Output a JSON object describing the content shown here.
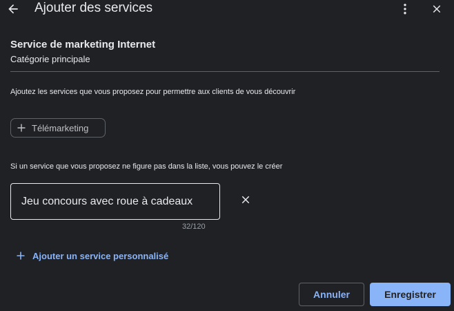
{
  "header": {
    "title": "Ajouter des services",
    "back_icon": "arrow-back-icon",
    "more_icon": "more-vert-icon",
    "close_icon": "close-icon"
  },
  "category": {
    "name": "Service de marketing Internet",
    "type": "Catégorie principale"
  },
  "suggested": {
    "hint": "Ajoutez les services que vous proposez pour permettre aux clients de vous découvrir",
    "chips": [
      {
        "label": "Télémarketing",
        "icon": "plus-icon"
      }
    ]
  },
  "custom": {
    "hint": "Si un service que vous proposez ne figure pas dans la liste, vous pouvez le créer",
    "input_value": "Jeu concours avec roue à cadeaux",
    "counter": "32/120",
    "clear_icon": "close-icon",
    "add_label": "Ajouter un service personnalisé",
    "add_icon": "plus-icon"
  },
  "actions": {
    "cancel_label": "Annuler",
    "save_label": "Enregistrer"
  },
  "colors": {
    "background": "#202124",
    "text": "#e8eaed",
    "accent": "#8ab4f8",
    "border": "#5f6368"
  }
}
